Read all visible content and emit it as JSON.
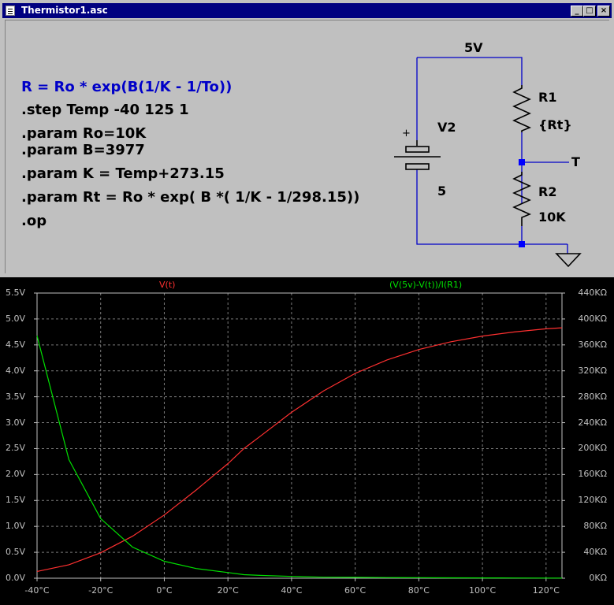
{
  "window": {
    "title": "Thermistor1.asc"
  },
  "schematic": {
    "directives": [
      "R = Ro * exp(B(1/K - 1/To))",
      ".step Temp -40 125 1",
      ".param Ro=10K",
      ".param B=3977",
      ".param K = Temp+273.15",
      ".param Rt = Ro * exp( B *( 1/K - 1/298.15))",
      ".op"
    ],
    "net_5v": "5V",
    "v2_name": "V2",
    "v2_value": "5",
    "v2_plus": "+",
    "r1_name": "R1",
    "r1_value": "{Rt}",
    "r2_name": "R2",
    "r2_value": "10K",
    "net_t": "T",
    "colors": {
      "wire": "#0000c8",
      "blue_text": "#0000c8"
    }
  },
  "plot": {
    "legend_left": "V(t)",
    "legend_right": "(V(5v)-V(t))/I(R1)",
    "left_ticks": [
      "0.0V",
      "0.5V",
      "1.0V",
      "1.5V",
      "2.0V",
      "2.5V",
      "3.0V",
      "3.5V",
      "4.0V",
      "4.5V",
      "5.0V",
      "5.5V"
    ],
    "right_ticks": [
      "0KΩ",
      "40KΩ",
      "80KΩ",
      "120KΩ",
      "160KΩ",
      "200KΩ",
      "240KΩ",
      "280KΩ",
      "320KΩ",
      "360KΩ",
      "400KΩ",
      "440KΩ"
    ],
    "x_ticks": [
      "-40°C",
      "-20°C",
      "0°C",
      "20°C",
      "40°C",
      "60°C",
      "80°C",
      "100°C",
      "120°C"
    ],
    "colors": {
      "left_series": "#ff3030",
      "right_series": "#00e000",
      "grid": "#7a7a7a",
      "axis": "#c0c0c0"
    }
  },
  "chart_data": {
    "type": "line",
    "x_label": "",
    "x_range": [
      -40,
      125
    ],
    "y_left_range": [
      0,
      5.5
    ],
    "y_right_range": [
      0,
      440
    ],
    "grid": true,
    "x": [
      -40,
      -30,
      -20,
      -10,
      0,
      10,
      20,
      25,
      30,
      40,
      50,
      60,
      70,
      80,
      90,
      100,
      110,
      120,
      125
    ],
    "series": [
      {
        "name": "V(t)",
        "axis": "left",
        "unit": "V",
        "values": [
          0.13,
          0.26,
          0.49,
          0.81,
          1.22,
          1.7,
          2.21,
          2.5,
          2.73,
          3.2,
          3.61,
          3.95,
          4.21,
          4.41,
          4.56,
          4.67,
          4.75,
          4.81,
          4.83
        ]
      },
      {
        "name": "(V(5v)-V(t))/I(R1)",
        "axis": "right",
        "unit": "KΩ",
        "values": [
          374,
          183,
          92,
          48,
          26.1,
          15.0,
          8.7,
          5.5,
          4.4,
          2.8,
          1.6,
          1.3,
          1.0,
          0.8,
          0.6,
          0.5,
          0.4,
          0.3,
          0.3
        ]
      }
    ]
  }
}
